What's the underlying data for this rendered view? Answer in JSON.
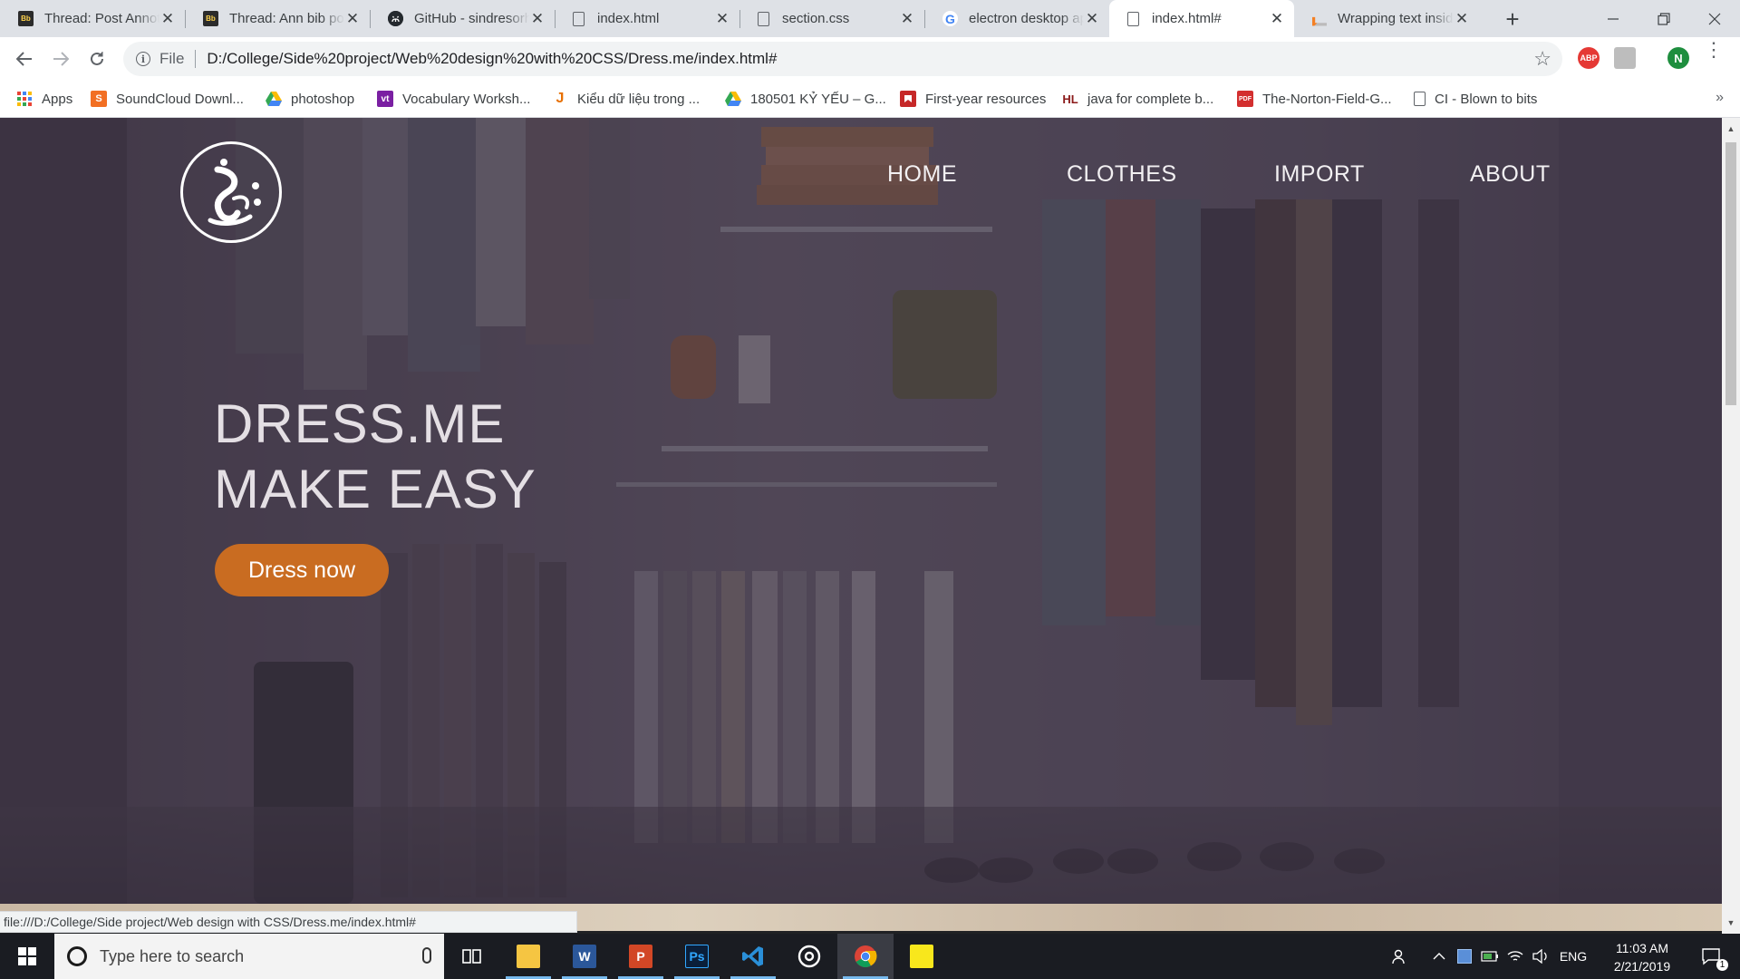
{
  "browser": {
    "tabs": [
      {
        "title": "Thread: Post Annotated",
        "favicon": "blackboard-icon",
        "active": false
      },
      {
        "title": "Thread: Ann bib post",
        "favicon": "blackboard-icon",
        "active": false
      },
      {
        "title": "GitHub - sindresorhus",
        "favicon": "github-icon",
        "active": false
      },
      {
        "title": "index.html",
        "favicon": "file-icon",
        "active": false
      },
      {
        "title": "section.css",
        "favicon": "file-icon",
        "active": false
      },
      {
        "title": "electron desktop app",
        "favicon": "google-icon",
        "active": false
      },
      {
        "title": "index.html#",
        "favicon": "file-icon",
        "active": true
      },
      {
        "title": "Wrapping text inside",
        "favicon": "stackoverflow-icon",
        "active": false
      }
    ],
    "omnibox": {
      "scheme_label": "File",
      "url": "D:/College/Side%20project/Web%20design%20with%20CSS/Dress.me/index.html#"
    },
    "profile_initial": "N",
    "ext_abp_label": "ABP",
    "bookmarks": [
      {
        "label": "Apps",
        "icon": "apps-grid-icon"
      },
      {
        "label": "SoundCloud Downl...",
        "icon": "soundcloud-icon",
        "icon_text": "S",
        "color": "#f26f23"
      },
      {
        "label": "photoshop",
        "icon": "google-drive-icon"
      },
      {
        "label": "Vocabulary Worksh...",
        "icon": "vocabulary-icon",
        "icon_text": "vt",
        "color": "#7a1fa2"
      },
      {
        "label": "Kiểu dữ liệu trong ...",
        "icon": "java-icon",
        "icon_text": "J",
        "color": "#e76f00"
      },
      {
        "label": "180501 KỶ YẾU – G...",
        "icon": "google-drive-icon"
      },
      {
        "label": "First-year resources",
        "icon": "bookmark-red-icon",
        "color": "#c62828"
      },
      {
        "label": "java for complete b...",
        "icon": "hl-icon",
        "icon_text": "HL",
        "color": "#8b1a1a"
      },
      {
        "label": "The-Norton-Field-G...",
        "icon": "pdf-icon",
        "icon_text": "PDF",
        "color": "#d32f2f"
      },
      {
        "label": "CI - Blown to bits",
        "icon": "file-icon"
      }
    ]
  },
  "page": {
    "logo_alt": "dress-me-logo",
    "nav": [
      "HOME",
      "CLOTHES",
      "IMPORT",
      "ABOUT"
    ],
    "headline_line1": "DRESS.ME",
    "headline_line2": "MAKE EASY",
    "cta_label": "Dress now",
    "status_url": "file:///D:/College/Side project/Web design with CSS/Dress.me/index.html#",
    "colors": {
      "accent": "#c96c21",
      "overlay": "#3a3242"
    }
  },
  "taskbar": {
    "search_placeholder": "Type here to search",
    "language": "ENG",
    "time": "11:03 AM",
    "date": "2/21/2019",
    "notification_count": "1"
  }
}
